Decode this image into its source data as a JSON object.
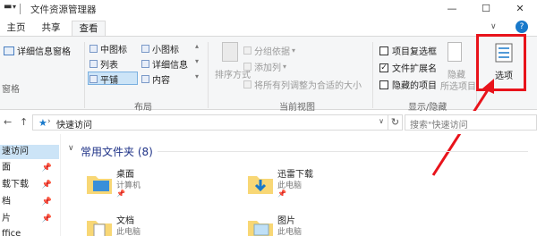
{
  "window": {
    "title": "文件资源管理器",
    "minimize": "—",
    "maximize": "☐",
    "close": "✕"
  },
  "tabs": [
    "文件",
    "主页",
    "共享",
    "查看"
  ],
  "ribbon": {
    "pane": {
      "details_pane": "详细信息窗格",
      "group_label": "窗格"
    },
    "layout": {
      "items": [
        "中图标",
        "小图标",
        "列表",
        "详细信息",
        "平铺",
        "内容"
      ],
      "group_label": "布局"
    },
    "current_view": {
      "sort": "排序方式",
      "group_by": "分组依据",
      "add_column": "添加列",
      "fit_columns": "将所有列调整为合适的大小",
      "group_label": "当前视图"
    },
    "show_hide": {
      "item_checkbox": "项目复选框",
      "extensions": "文件扩展名",
      "hidden_items": "隐藏的项目",
      "hide_selected_1": "隐藏",
      "hide_selected_2": "所选项目",
      "group_label": "显示/隐藏"
    },
    "options_label": "选项"
  },
  "address": {
    "back": "←",
    "up": "↑",
    "path": "快速访问",
    "search_placeholder": "搜索\"快速访问"
  },
  "nav": {
    "items": [
      "速访问",
      "面",
      "载下载",
      "档",
      "片",
      "ffice"
    ],
    "pin": "📌"
  },
  "content": {
    "section": "常用文件夹 (8)",
    "folders": [
      {
        "name": "桌面",
        "loc": "计算机"
      },
      {
        "name": "迅雷下载",
        "loc": "此电脑"
      },
      {
        "name": "文档",
        "loc": "此电脑"
      },
      {
        "name": "图片",
        "loc": "此电脑"
      }
    ]
  },
  "colors": {
    "accent": "#1979ca",
    "highlight": "#e8131b",
    "selection": "#cce4f7"
  }
}
